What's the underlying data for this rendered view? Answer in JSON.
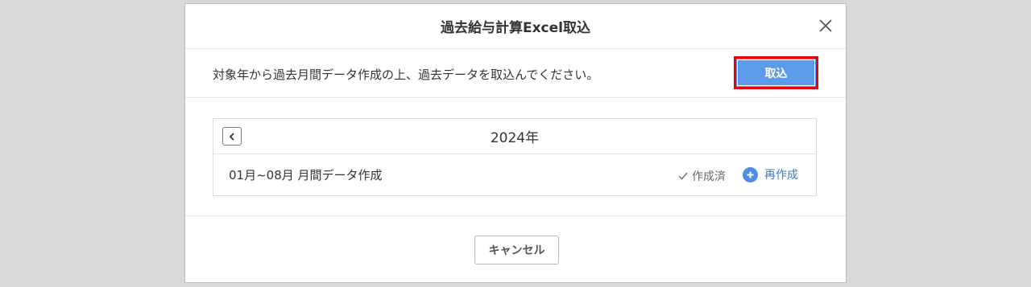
{
  "modal": {
    "title": "過去給与計算Excel取込",
    "description": "対象年から過去月間データ作成の上、過去データを取込んでください。",
    "import_button": "取込",
    "cancel_button": "キャンセル"
  },
  "year_panel": {
    "year": "2024年",
    "rows": [
      {
        "label": "01月~08月 月間データ作成",
        "status": "作成済",
        "action": "再作成"
      }
    ]
  },
  "colors": {
    "accent": "#5b9bea",
    "highlight_border": "#e8000f",
    "link": "#3c78c8"
  },
  "icons": {
    "close": "close-icon",
    "prev": "chevron-left-icon",
    "status": "check-icon",
    "action": "plus-circle-icon"
  }
}
